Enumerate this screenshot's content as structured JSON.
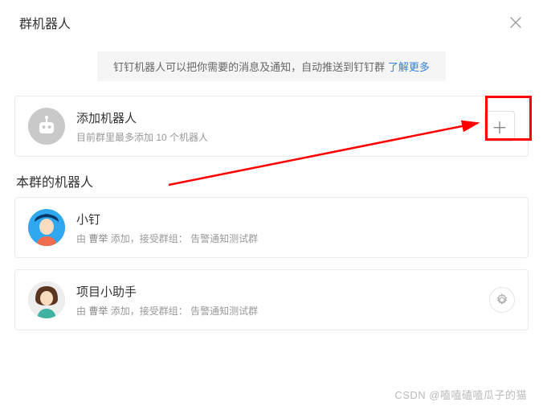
{
  "header": {
    "title": "群机器人"
  },
  "notice": {
    "text": "钉钉机器人可以把你需要的消息及通知，自动推送到钉钉群",
    "link_label": "了解更多"
  },
  "add_section": {
    "title": "添加机器人",
    "subtitle": "目前群里最多添加 10 个机器人"
  },
  "section_title": "本群的机器人",
  "robots": [
    {
      "name": "小钉",
      "by_label": "由",
      "author": "曹举",
      "add_label": "添加，接受群组：",
      "group": "告警通知测试群"
    },
    {
      "name": "项目小助手",
      "by_label": "由",
      "author": "曹举",
      "add_label": "添加，接受群组：",
      "group": "告警通知测试群"
    }
  ],
  "watermark": "CSDN @嗑嗑磕嗑瓜子的猫"
}
